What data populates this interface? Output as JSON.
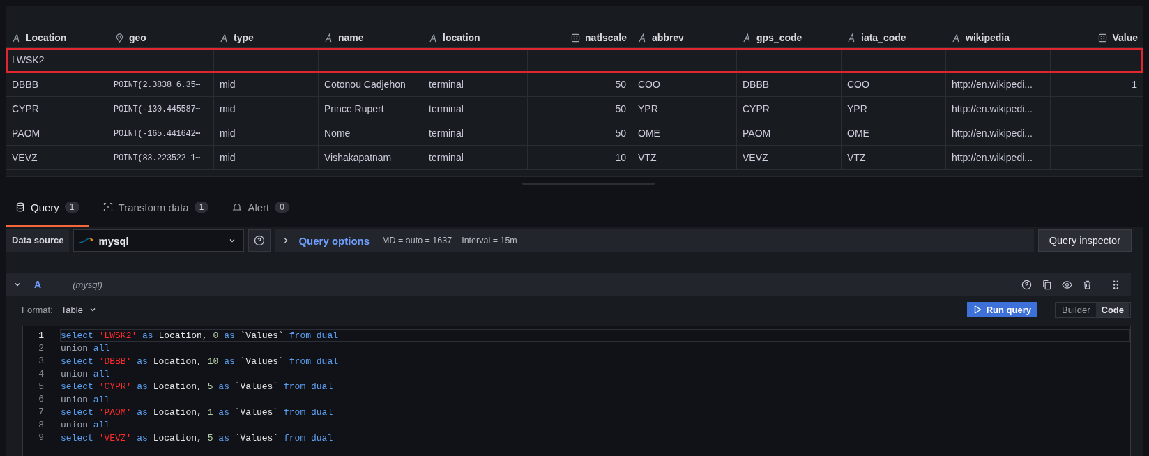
{
  "table": {
    "columns": [
      {
        "name": "Location",
        "kind": "text"
      },
      {
        "name": "geo",
        "kind": "geo"
      },
      {
        "name": "type",
        "kind": "text"
      },
      {
        "name": "name",
        "kind": "text"
      },
      {
        "name": "location",
        "kind": "text"
      },
      {
        "name": "natlscale",
        "kind": "number"
      },
      {
        "name": "abbrev",
        "kind": "text"
      },
      {
        "name": "gps_code",
        "kind": "text"
      },
      {
        "name": "iata_code",
        "kind": "text"
      },
      {
        "name": "wikipedia",
        "kind": "text"
      },
      {
        "name": "Value",
        "kind": "number"
      }
    ],
    "rows": [
      {
        "selected": true,
        "cells": [
          "LWSK2",
          null,
          null,
          null,
          null,
          null,
          null,
          null,
          null,
          null,
          null
        ]
      },
      {
        "selected": false,
        "cells": [
          "DBBB",
          "POINT(2.3838 6.35⋯",
          "mid",
          "Cotonou Cadjehon",
          "terminal",
          "50",
          "COO",
          "DBBB",
          "COO",
          "http://en.wikipedi...",
          "1"
        ]
      },
      {
        "selected": false,
        "cells": [
          "CYPR",
          "POINT(-130.445587⋯",
          "mid",
          "Prince Rupert",
          "terminal",
          "50",
          "YPR",
          "CYPR",
          "YPR",
          "http://en.wikipedi...",
          null
        ]
      },
      {
        "selected": false,
        "cells": [
          "PAOM",
          "POINT(-165.441642⋯",
          "mid",
          "Nome",
          "terminal",
          "50",
          "OME",
          "PAOM",
          "OME",
          "http://en.wikipedi...",
          null
        ]
      },
      {
        "selected": false,
        "cells": [
          "VEVZ",
          "POINT(83.223522 1⋯",
          "mid",
          "Vishakapatnam",
          "terminal",
          "10",
          "VTZ",
          "VEVZ",
          "VTZ",
          "http://en.wikipedi...",
          null
        ]
      }
    ]
  },
  "tabs": [
    {
      "label": "Query",
      "count": "1",
      "kind": "query",
      "selected": true
    },
    {
      "label": "Transform data",
      "count": "1",
      "kind": "transform",
      "selected": false
    },
    {
      "label": "Alert",
      "count": "0",
      "kind": "alert",
      "selected": false
    }
  ],
  "toolbar": {
    "datasource_label": "Data source",
    "datasource": "mysql",
    "query_options": "Query options",
    "md": "MD = auto = 1637",
    "interval": "Interval = 15m",
    "inspector": "Query inspector"
  },
  "query": {
    "ref": "A",
    "datasource": "(mysql)",
    "format_label": "Format:",
    "format": "Table",
    "run": "Run query",
    "modes": [
      {
        "label": "Builder",
        "selected": false
      },
      {
        "label": "Code",
        "selected": true
      }
    ],
    "lines": [
      {
        "number": "1",
        "active": true,
        "tokens": [
          {
            "kind": "kw",
            "text": "select"
          },
          {
            "kind": "str",
            "text": "'LWSK2'"
          },
          {
            "kind": "kw",
            "text": "as"
          },
          {
            "kind": "id",
            "text": "Location,"
          },
          {
            "kind": "num",
            "text": "0"
          },
          {
            "kind": "kw",
            "text": "as"
          },
          {
            "kind": "id",
            "text": "`Values`"
          },
          {
            "kind": "kw",
            "text": "from"
          },
          {
            "kind": "kw",
            "text": "dual"
          }
        ]
      },
      {
        "number": "2",
        "active": false,
        "tokens": [
          {
            "kind": "op",
            "text": "union"
          },
          {
            "kind": "kw",
            "text": "all"
          }
        ]
      },
      {
        "number": "3",
        "active": false,
        "tokens": [
          {
            "kind": "kw",
            "text": "select"
          },
          {
            "kind": "str",
            "text": "'DBBB'"
          },
          {
            "kind": "kw",
            "text": "as"
          },
          {
            "kind": "id",
            "text": "Location,"
          },
          {
            "kind": "num",
            "text": "10"
          },
          {
            "kind": "kw",
            "text": "as"
          },
          {
            "kind": "id",
            "text": "`Values`"
          },
          {
            "kind": "kw",
            "text": "from"
          },
          {
            "kind": "kw",
            "text": "dual"
          }
        ]
      },
      {
        "number": "4",
        "active": false,
        "tokens": [
          {
            "kind": "op",
            "text": "union"
          },
          {
            "kind": "kw",
            "text": "all"
          }
        ]
      },
      {
        "number": "5",
        "active": false,
        "tokens": [
          {
            "kind": "kw",
            "text": "select"
          },
          {
            "kind": "str",
            "text": "'CYPR'"
          },
          {
            "kind": "kw",
            "text": "as"
          },
          {
            "kind": "id",
            "text": "Location,"
          },
          {
            "kind": "num",
            "text": "5"
          },
          {
            "kind": "kw",
            "text": "as"
          },
          {
            "kind": "id",
            "text": "`Values`"
          },
          {
            "kind": "kw",
            "text": "from"
          },
          {
            "kind": "kw",
            "text": "dual"
          }
        ]
      },
      {
        "number": "6",
        "active": false,
        "tokens": [
          {
            "kind": "op",
            "text": "union"
          },
          {
            "kind": "kw",
            "text": "all"
          }
        ]
      },
      {
        "number": "7",
        "active": false,
        "tokens": [
          {
            "kind": "kw",
            "text": "select"
          },
          {
            "kind": "str",
            "text": "'PAOM'"
          },
          {
            "kind": "kw",
            "text": "as"
          },
          {
            "kind": "id",
            "text": "Location,"
          },
          {
            "kind": "num",
            "text": "1"
          },
          {
            "kind": "kw",
            "text": "as"
          },
          {
            "kind": "id",
            "text": "`Values`"
          },
          {
            "kind": "kw",
            "text": "from"
          },
          {
            "kind": "kw",
            "text": "dual"
          }
        ]
      },
      {
        "number": "8",
        "active": false,
        "tokens": [
          {
            "kind": "op",
            "text": "union"
          },
          {
            "kind": "kw",
            "text": "all"
          }
        ]
      },
      {
        "number": "9",
        "active": false,
        "tokens": [
          {
            "kind": "kw",
            "text": "select"
          },
          {
            "kind": "str",
            "text": "'VEVZ'"
          },
          {
            "kind": "kw",
            "text": "as"
          },
          {
            "kind": "id",
            "text": "Location,"
          },
          {
            "kind": "num",
            "text": "5"
          },
          {
            "kind": "kw",
            "text": "as"
          },
          {
            "kind": "id",
            "text": "`Values`"
          },
          {
            "kind": "kw",
            "text": "from"
          },
          {
            "kind": "kw",
            "text": "dual"
          }
        ]
      }
    ]
  }
}
